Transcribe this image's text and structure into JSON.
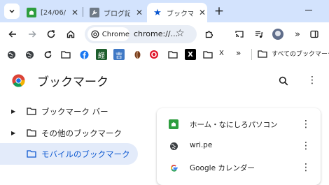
{
  "tabs": [
    {
      "title": "[24/06/0",
      "icon": "green-site-icon",
      "active": false
    },
    {
      "title": "ブログ記事",
      "icon": "wrench-icon",
      "active": false
    },
    {
      "title": "ブックマー",
      "icon": "star-icon",
      "active": true
    }
  ],
  "omnibox": {
    "chip_label": "Chrome",
    "url": "chrome://..."
  },
  "bookmarks_bar": {
    "items": [
      {
        "icon": "globe-icon"
      },
      {
        "icon": "globe-icon"
      },
      {
        "icon": "refresh-icon"
      },
      {
        "icon": "folder-icon"
      },
      {
        "icon": "facebook-icon"
      },
      {
        "icon": "nikkei-icon",
        "glyph": "経"
      },
      {
        "icon": "kichi-icon",
        "glyph": "吉"
      },
      {
        "icon": "coffee-icon"
      },
      {
        "icon": "target-icon"
      },
      {
        "icon": "folder-icon"
      },
      {
        "icon": "x-icon",
        "glyph": "X"
      }
    ],
    "x_label": "X",
    "more_label": "»",
    "all_bookmarks_label": "すべてのブックマーク"
  },
  "page": {
    "title": "ブックマーク",
    "tree": [
      {
        "label": "ブックマーク バー",
        "expandable": true,
        "selected": false
      },
      {
        "label": "その他のブックマーク",
        "expandable": true,
        "selected": false
      },
      {
        "label": "モバイルのブックマーク",
        "expandable": false,
        "selected": true
      }
    ],
    "bookmarks": [
      {
        "title": "ホーム・なにしろパソコン",
        "icon": "green-site-icon"
      },
      {
        "title": "wri.pe",
        "icon": "globe-icon"
      },
      {
        "title": "Google カレンダー",
        "icon": "google-icon"
      }
    ]
  },
  "colors": {
    "tabstrip": "#d3e3fd",
    "accent": "#0b57d0",
    "selected_bg": "#e3ebfa",
    "site_green": "#2e9e3f"
  }
}
